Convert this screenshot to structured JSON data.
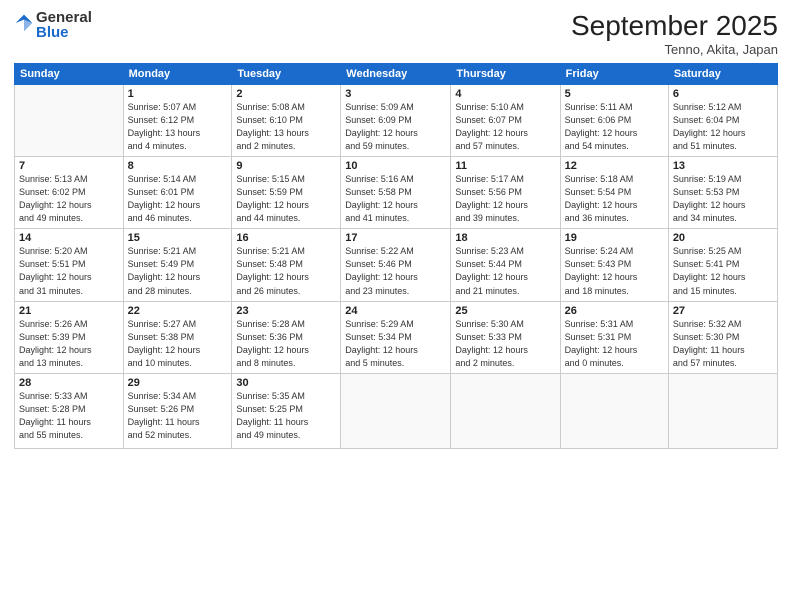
{
  "logo": {
    "general": "General",
    "blue": "Blue"
  },
  "header": {
    "month_year": "September 2025",
    "location": "Tenno, Akita, Japan"
  },
  "weekdays": [
    "Sunday",
    "Monday",
    "Tuesday",
    "Wednesday",
    "Thursday",
    "Friday",
    "Saturday"
  ],
  "weeks": [
    [
      {
        "day": "",
        "info": ""
      },
      {
        "day": "1",
        "info": "Sunrise: 5:07 AM\nSunset: 6:12 PM\nDaylight: 13 hours\nand 4 minutes."
      },
      {
        "day": "2",
        "info": "Sunrise: 5:08 AM\nSunset: 6:10 PM\nDaylight: 13 hours\nand 2 minutes."
      },
      {
        "day": "3",
        "info": "Sunrise: 5:09 AM\nSunset: 6:09 PM\nDaylight: 12 hours\nand 59 minutes."
      },
      {
        "day": "4",
        "info": "Sunrise: 5:10 AM\nSunset: 6:07 PM\nDaylight: 12 hours\nand 57 minutes."
      },
      {
        "day": "5",
        "info": "Sunrise: 5:11 AM\nSunset: 6:06 PM\nDaylight: 12 hours\nand 54 minutes."
      },
      {
        "day": "6",
        "info": "Sunrise: 5:12 AM\nSunset: 6:04 PM\nDaylight: 12 hours\nand 51 minutes."
      }
    ],
    [
      {
        "day": "7",
        "info": "Sunrise: 5:13 AM\nSunset: 6:02 PM\nDaylight: 12 hours\nand 49 minutes."
      },
      {
        "day": "8",
        "info": "Sunrise: 5:14 AM\nSunset: 6:01 PM\nDaylight: 12 hours\nand 46 minutes."
      },
      {
        "day": "9",
        "info": "Sunrise: 5:15 AM\nSunset: 5:59 PM\nDaylight: 12 hours\nand 44 minutes."
      },
      {
        "day": "10",
        "info": "Sunrise: 5:16 AM\nSunset: 5:58 PM\nDaylight: 12 hours\nand 41 minutes."
      },
      {
        "day": "11",
        "info": "Sunrise: 5:17 AM\nSunset: 5:56 PM\nDaylight: 12 hours\nand 39 minutes."
      },
      {
        "day": "12",
        "info": "Sunrise: 5:18 AM\nSunset: 5:54 PM\nDaylight: 12 hours\nand 36 minutes."
      },
      {
        "day": "13",
        "info": "Sunrise: 5:19 AM\nSunset: 5:53 PM\nDaylight: 12 hours\nand 34 minutes."
      }
    ],
    [
      {
        "day": "14",
        "info": "Sunrise: 5:20 AM\nSunset: 5:51 PM\nDaylight: 12 hours\nand 31 minutes."
      },
      {
        "day": "15",
        "info": "Sunrise: 5:21 AM\nSunset: 5:49 PM\nDaylight: 12 hours\nand 28 minutes."
      },
      {
        "day": "16",
        "info": "Sunrise: 5:21 AM\nSunset: 5:48 PM\nDaylight: 12 hours\nand 26 minutes."
      },
      {
        "day": "17",
        "info": "Sunrise: 5:22 AM\nSunset: 5:46 PM\nDaylight: 12 hours\nand 23 minutes."
      },
      {
        "day": "18",
        "info": "Sunrise: 5:23 AM\nSunset: 5:44 PM\nDaylight: 12 hours\nand 21 minutes."
      },
      {
        "day": "19",
        "info": "Sunrise: 5:24 AM\nSunset: 5:43 PM\nDaylight: 12 hours\nand 18 minutes."
      },
      {
        "day": "20",
        "info": "Sunrise: 5:25 AM\nSunset: 5:41 PM\nDaylight: 12 hours\nand 15 minutes."
      }
    ],
    [
      {
        "day": "21",
        "info": "Sunrise: 5:26 AM\nSunset: 5:39 PM\nDaylight: 12 hours\nand 13 minutes."
      },
      {
        "day": "22",
        "info": "Sunrise: 5:27 AM\nSunset: 5:38 PM\nDaylight: 12 hours\nand 10 minutes."
      },
      {
        "day": "23",
        "info": "Sunrise: 5:28 AM\nSunset: 5:36 PM\nDaylight: 12 hours\nand 8 minutes."
      },
      {
        "day": "24",
        "info": "Sunrise: 5:29 AM\nSunset: 5:34 PM\nDaylight: 12 hours\nand 5 minutes."
      },
      {
        "day": "25",
        "info": "Sunrise: 5:30 AM\nSunset: 5:33 PM\nDaylight: 12 hours\nand 2 minutes."
      },
      {
        "day": "26",
        "info": "Sunrise: 5:31 AM\nSunset: 5:31 PM\nDaylight: 12 hours\nand 0 minutes."
      },
      {
        "day": "27",
        "info": "Sunrise: 5:32 AM\nSunset: 5:30 PM\nDaylight: 11 hours\nand 57 minutes."
      }
    ],
    [
      {
        "day": "28",
        "info": "Sunrise: 5:33 AM\nSunset: 5:28 PM\nDaylight: 11 hours\nand 55 minutes."
      },
      {
        "day": "29",
        "info": "Sunrise: 5:34 AM\nSunset: 5:26 PM\nDaylight: 11 hours\nand 52 minutes."
      },
      {
        "day": "30",
        "info": "Sunrise: 5:35 AM\nSunset: 5:25 PM\nDaylight: 11 hours\nand 49 minutes."
      },
      {
        "day": "",
        "info": ""
      },
      {
        "day": "",
        "info": ""
      },
      {
        "day": "",
        "info": ""
      },
      {
        "day": "",
        "info": ""
      }
    ]
  ]
}
